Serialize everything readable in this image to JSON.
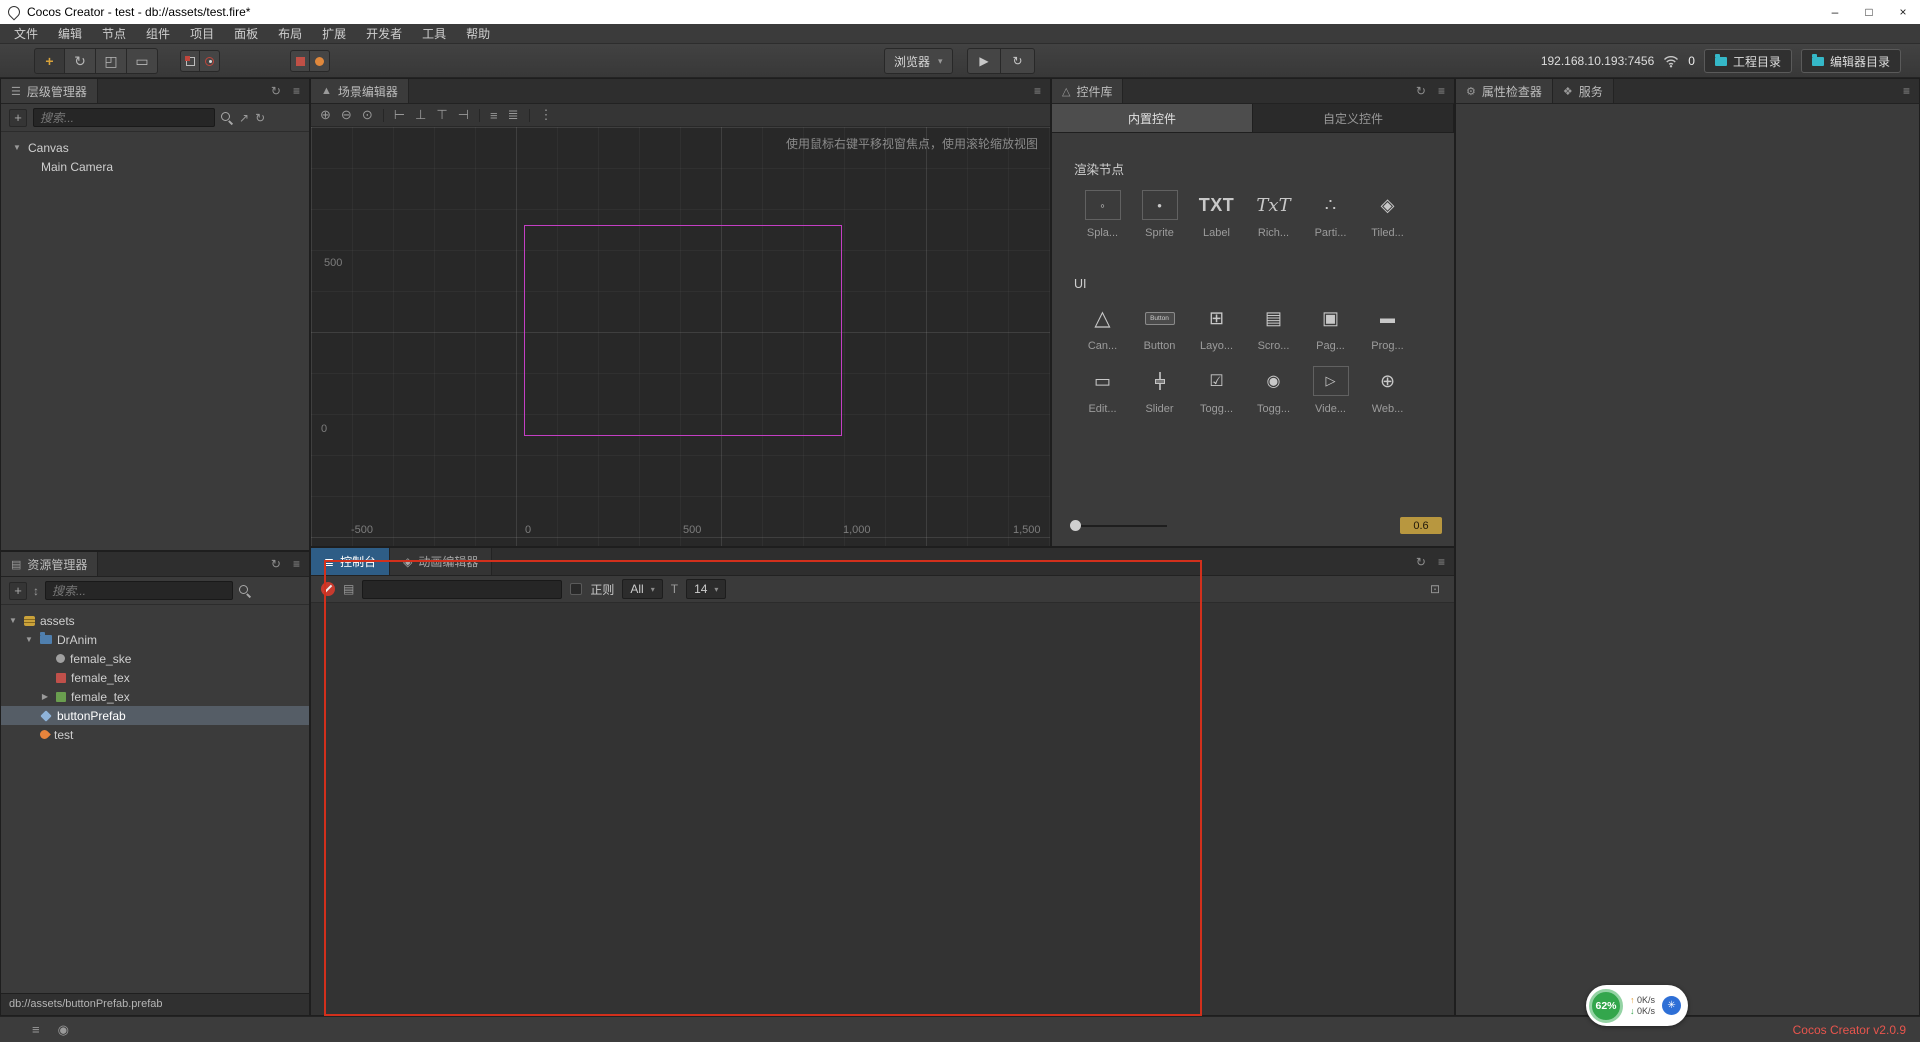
{
  "titlebar": {
    "title": "Cocos Creator - test - db://assets/test.fire*"
  },
  "menu": {
    "items": [
      "文件",
      "编辑",
      "节点",
      "组件",
      "项目",
      "面板",
      "布局",
      "扩展",
      "开发者",
      "工具",
      "帮助"
    ]
  },
  "toolbar": {
    "preview_target": "浏览器",
    "address": "192.168.10.193:7456",
    "connected_count": "0",
    "project_dir_label": "工程目录",
    "editor_dir_label": "编辑器目录"
  },
  "hierarchy": {
    "title": "层级管理器",
    "search_placeholder": "搜索...",
    "nodes": [
      {
        "label": "Canvas"
      },
      {
        "label": "Main Camera"
      }
    ]
  },
  "scene": {
    "title": "场景编辑器",
    "hint": "使用鼠标右键平移视窗焦点，使用滚轮缩放视图",
    "ruler_y": [
      "500",
      "0"
    ],
    "ruler_x": [
      "-500",
      "0",
      "500",
      "1,000",
      "1,500"
    ]
  },
  "library": {
    "title": "控件库",
    "tab_builtin": "内置控件",
    "tab_custom": "自定义控件",
    "section_render": "渲染节点",
    "section_ui": "UI",
    "render_items": [
      "Spla...",
      "Sprite",
      "Label",
      "Rich...",
      "Parti...",
      "Tiled..."
    ],
    "ui_items": [
      "Can...",
      "Button",
      "Layo...",
      "Scro...",
      "Pag...",
      "Prog...",
      "Edit...",
      "Slider",
      "Togg...",
      "Togg...",
      "Vide...",
      "Web..."
    ],
    "glyph_label": "TXT",
    "glyph_rich": "TxT",
    "glyph_button": "Button",
    "zoom_value": "0.6"
  },
  "console": {
    "tab_console": "控制台",
    "tab_animation": "动画编辑器",
    "regex_label": "正则",
    "filter_selected": "All",
    "fontsize_selected": "14"
  },
  "inspector": {
    "tab_properties": "属性检查器",
    "tab_service": "服务"
  },
  "assets": {
    "title": "资源管理器",
    "search_placeholder": "搜索...",
    "items": [
      {
        "label": "assets"
      },
      {
        "label": "DrAnim"
      },
      {
        "label": "female_ske"
      },
      {
        "label": "female_tex"
      },
      {
        "label": "female_tex"
      },
      {
        "label": "buttonPrefab"
      },
      {
        "label": "test"
      }
    ],
    "selected_path": "db://assets/buttonPrefab.prefab"
  },
  "footer": {
    "version": "Cocos Creator v2.0.9"
  },
  "progress_widget": {
    "percent": "62%",
    "upload": "0K/s",
    "download": "0K/s"
  },
  "icons": {
    "minimize": "–",
    "maximize": "□",
    "close": "×",
    "caret": "▾",
    "tri_open": "▼",
    "tri_closed": "▶",
    "play": "▶",
    "refresh": "↻",
    "menu": "≡",
    "expand": "↗",
    "plus": "+",
    "sort": "↕",
    "move_tool": "+",
    "rotate_tool": "↻",
    "scale_tool": "◰",
    "rect_tool": "▭",
    "zoom_in": "⊕",
    "zoom_out": "⊖",
    "zoom_reset": "⊙",
    "align_left": "⊢",
    "align_bottom": "⊥",
    "align_top": "⊤",
    "align_right": "⊣",
    "dist_h": "≡",
    "dist_v": "≣",
    "more": "⋮",
    "doc": "▤",
    "collapse": "⊡",
    "font_size": "T",
    "tab_hierarchy": "☰",
    "tab_scene": "▲",
    "tab_assets": "▤",
    "tab_console": "≣",
    "tab_animation": "◈",
    "tab_library": "△",
    "tab_inspector": "⚙",
    "tab_service": "❖",
    "up_arrow": "↑",
    "down_arrow": "↓",
    "dashboard": "✳",
    "g_spla": "◦",
    "g_sprite": "•",
    "g_parti": "∴",
    "g_tiled": "◈",
    "g_canvas": "△",
    "g_layout": "⊞",
    "g_scroll": "▤",
    "g_page": "▣",
    "g_progress": "▬",
    "g_edit": "▭",
    "g_toggle": "☑",
    "g_toggle_group": "◉",
    "g_video": "▷",
    "g_web": "⊕"
  }
}
